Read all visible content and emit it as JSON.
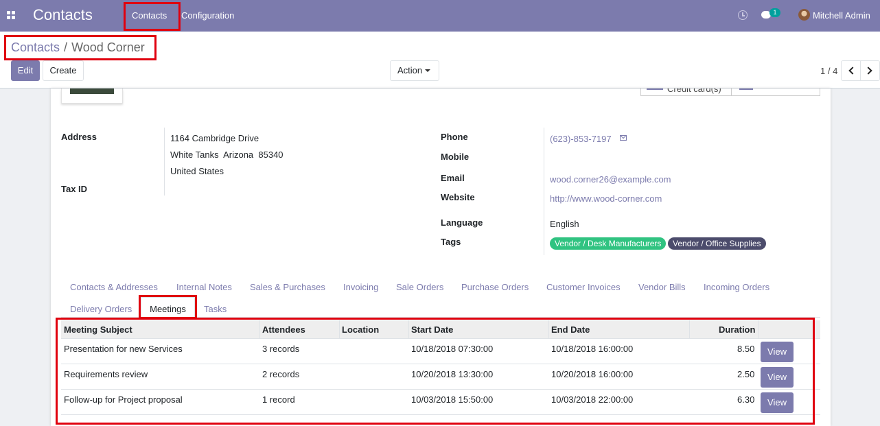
{
  "navbar": {
    "app_title": "Contacts",
    "menu": [
      "Contacts",
      "Configuration"
    ],
    "chat_badge": "1",
    "user_name": "Mitchell Admin",
    "colors": {
      "navbar_bg": "#7c7bad",
      "badge": "#00a09d",
      "highlight": "#e0000e"
    }
  },
  "breadcrumb": {
    "parent": "Contacts",
    "separator": "/",
    "current": "Wood Corner"
  },
  "buttons": {
    "edit": "Edit",
    "create": "Create",
    "action": "Action"
  },
  "pager": {
    "value": "1 / 4"
  },
  "smart_buttons": {
    "credit_card_label": "Credit card(s)"
  },
  "address": {
    "label": "Address",
    "street": "1164 Cambridge Drive",
    "city_line": "White Tanks  Arizona  85340",
    "country": "United States",
    "tax_label": "Tax ID"
  },
  "contact": {
    "phone_label": "Phone",
    "phone": "(623)-853-7197",
    "mobile_label": "Mobile",
    "email_label": "Email",
    "email": "wood.corner26@example.com",
    "website_label": "Website",
    "website": "http://www.wood-corner.com",
    "language_label": "Language",
    "language": "English",
    "tags_label": "Tags",
    "tags": [
      {
        "label": "Vendor / Desk Manufacturers",
        "color": "#30c381"
      },
      {
        "label": "Vendor / Office Supplies",
        "color": "#4c4c6c"
      }
    ]
  },
  "tabs": [
    "Contacts & Addresses",
    "Internal Notes",
    "Sales & Purchases",
    "Invoicing",
    "Sale Orders",
    "Purchase Orders",
    "Customer Invoices",
    "Vendor Bills",
    "Incoming Orders",
    "Delivery Orders",
    "Meetings",
    "Tasks"
  ],
  "active_tab": "Meetings",
  "meetings": {
    "columns": [
      "Meeting Subject",
      "Attendees",
      "Location",
      "Start Date",
      "End Date",
      "Duration"
    ],
    "rows": [
      {
        "subject": "Presentation for new Services",
        "attendees": "3 records",
        "location": "",
        "start": "10/18/2018 07:30:00",
        "end": "10/18/2018 16:00:00",
        "duration": "8.50",
        "action": "View"
      },
      {
        "subject": "Requirements review",
        "attendees": "2 records",
        "location": "",
        "start": "10/20/2018 13:30:00",
        "end": "10/20/2018 16:00:00",
        "duration": "2.50",
        "action": "View"
      },
      {
        "subject": "Follow-up for Project proposal",
        "attendees": "1 record",
        "location": "",
        "start": "10/03/2018 15:50:00",
        "end": "10/03/2018 22:00:00",
        "duration": "6.30",
        "action": "View"
      }
    ]
  }
}
